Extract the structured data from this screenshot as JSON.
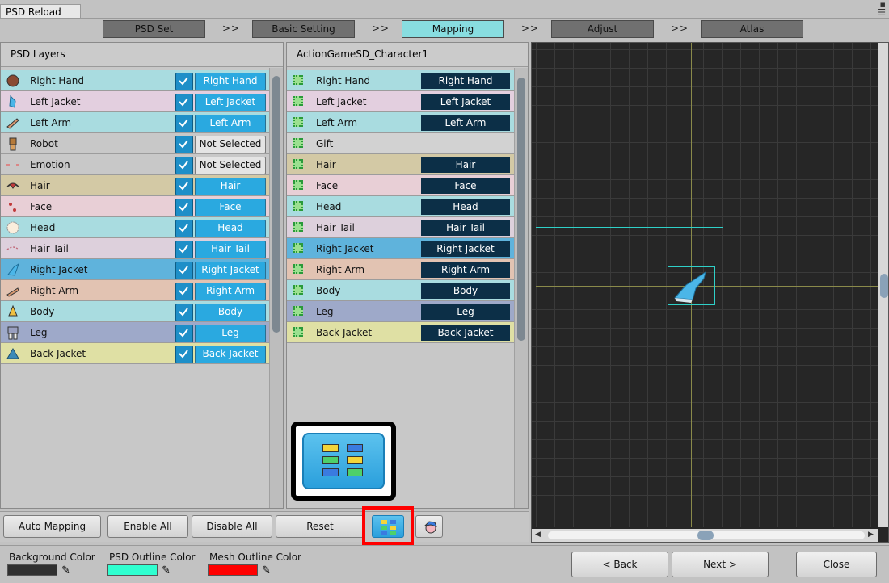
{
  "window": {
    "title": "PSD Reload"
  },
  "steps": [
    {
      "label": "PSD Set",
      "active": false
    },
    {
      "label": "Basic Setting",
      "active": false
    },
    {
      "label": "Mapping",
      "active": true
    },
    {
      "label": "Adjust",
      "active": false
    },
    {
      "label": "Atlas",
      "active": false
    }
  ],
  "step_separator": ">>",
  "psd_panel": {
    "header": "PSD Layers",
    "rows": [
      {
        "name": "Right Hand",
        "icon": "right-hand-icon",
        "checked": true,
        "mapped": "Right Hand",
        "color": "#a9dce0"
      },
      {
        "name": "Left Jacket",
        "icon": "left-jacket-icon",
        "checked": true,
        "mapped": "Left Jacket",
        "color": "#e3cfdf"
      },
      {
        "name": "Left Arm",
        "icon": "left-arm-icon",
        "checked": true,
        "mapped": "Left Arm",
        "color": "#a9dce0"
      },
      {
        "name": "Robot",
        "icon": "robot-icon",
        "checked": true,
        "mapped": "Not Selected",
        "color": "#c8c8c8"
      },
      {
        "name": "Emotion",
        "icon": "emotion-icon",
        "checked": true,
        "mapped": "Not Selected",
        "color": "#c8c8c8"
      },
      {
        "name": "Hair",
        "icon": "hair-icon",
        "checked": true,
        "mapped": "Hair",
        "color": "#d3c9a5"
      },
      {
        "name": "Face",
        "icon": "face-icon",
        "checked": true,
        "mapped": "Face",
        "color": "#e8cfd6"
      },
      {
        "name": "Head",
        "icon": "head-icon",
        "checked": true,
        "mapped": "Head",
        "color": "#a9dce0"
      },
      {
        "name": "Hair Tail",
        "icon": "hair-tail-icon",
        "checked": true,
        "mapped": "Hair Tail",
        "color": "#ddd0dc"
      },
      {
        "name": "Right Jacket",
        "icon": "right-jacket-icon",
        "checked": true,
        "mapped": "Right Jacket",
        "color": "#5fb3dc"
      },
      {
        "name": "Right Arm",
        "icon": "right-arm-icon",
        "checked": true,
        "mapped": "Right Arm",
        "color": "#e2c3b2"
      },
      {
        "name": "Body",
        "icon": "body-icon",
        "checked": true,
        "mapped": "Body",
        "color": "#a9dce0"
      },
      {
        "name": "Leg",
        "icon": "leg-icon",
        "checked": true,
        "mapped": "Leg",
        "color": "#9ea9c9"
      },
      {
        "name": "Back Jacket",
        "icon": "back-jacket-icon",
        "checked": true,
        "mapped": "Back Jacket",
        "color": "#dfe0a4"
      }
    ]
  },
  "mesh_panel": {
    "header": "ActionGameSD_Character1",
    "rows": [
      {
        "name": "Right Hand",
        "mapped": "Right Hand",
        "color": "#a9dce0"
      },
      {
        "name": "Left Jacket",
        "mapped": "Left Jacket",
        "color": "#e3cfdf"
      },
      {
        "name": "Left Arm",
        "mapped": "Left Arm",
        "color": "#a9dce0"
      },
      {
        "name": "Gift",
        "mapped": "",
        "color": "#d2d2d2"
      },
      {
        "name": "Hair",
        "mapped": "Hair",
        "color": "#d3c9a5"
      },
      {
        "name": "Face",
        "mapped": "Face",
        "color": "#e8cfd6"
      },
      {
        "name": "Head",
        "mapped": "Head",
        "color": "#a9dce0"
      },
      {
        "name": "Hair Tail",
        "mapped": "Hair Tail",
        "color": "#ddd0dc"
      },
      {
        "name": "Right Jacket",
        "mapped": "Right Jacket",
        "color": "#5fb3dc"
      },
      {
        "name": "Right Arm",
        "mapped": "Right Arm",
        "color": "#e2c3b2"
      },
      {
        "name": "Body",
        "mapped": "Body",
        "color": "#a9dce0"
      },
      {
        "name": "Leg",
        "mapped": "Leg",
        "color": "#9ea9c9"
      },
      {
        "name": "Back Jacket",
        "mapped": "Back Jacket",
        "color": "#dfe0a4"
      }
    ]
  },
  "bottom_buttons": {
    "auto_mapping": "Auto Mapping",
    "enable_all": "Enable All",
    "disable_all": "Disable All",
    "reset": "Reset"
  },
  "footer": {
    "background_color_label": "Background Color",
    "background_color": "#303030",
    "psd_outline_label": "PSD Outline Color",
    "psd_outline_color": "#2fffd0",
    "mesh_outline_label": "Mesh Outline Color",
    "mesh_outline_color": "#ff0000",
    "back": "< Back",
    "next": "Next >",
    "close": "Close"
  },
  "colors": {
    "highlight_box": "#ff0000",
    "mapped_button": "#2aa9e0",
    "mesh_value_bg": "#0c2f47"
  }
}
